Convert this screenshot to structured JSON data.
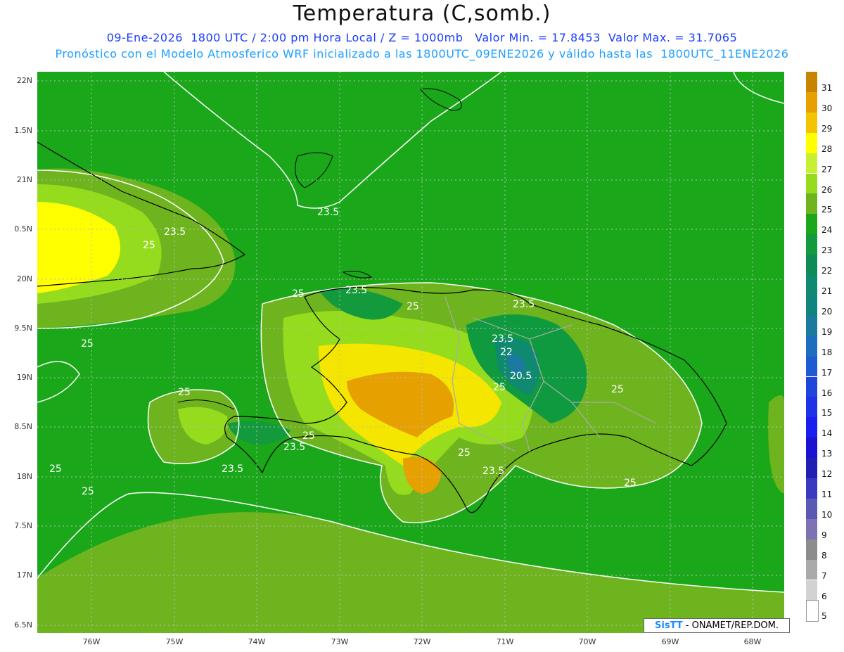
{
  "title": "Temperatura (C,somb.)",
  "subtitle_line1": "09-Ene-2026  1800 UTC / 2:00 pm Hora Local / Z = 1000mb   Valor Min. = 17.8453  Valor Max. = 31.7065",
  "subtitle_line2": "Pronóstico con el Modelo Atmosferico WRF inicializado a las 1800UTC_09ENE2026 y válido hasta las  1800UTC_11ENE2026",
  "credit": {
    "brand": "SisTT",
    "text": " - ONAMET/REP.DOM."
  },
  "lat_labels": [
    "22N",
    "1.5N",
    "21N",
    "0.5N",
    "20N",
    "9.5N",
    "19N",
    "8.5N",
    "18N",
    "7.5N",
    "17N",
    "6.5N"
  ],
  "lon_labels": [
    "76W",
    "75W",
    "74W",
    "73W",
    "72W",
    "71W",
    "70W",
    "69W",
    "68W"
  ],
  "contour_labels": [
    "23.5",
    "23.5",
    "25",
    "23.5",
    "25",
    "23.5",
    "25",
    "23.5",
    "23.5",
    "22",
    "20.5",
    "25",
    "25",
    "25",
    "23.5",
    "25",
    "25",
    "25",
    "25",
    "23.5",
    "25",
    "25"
  ],
  "colorbar": {
    "levels": [
      "31",
      "30",
      "29",
      "28",
      "27",
      "26",
      "25",
      "24",
      "23",
      "22",
      "21",
      "20",
      "19",
      "18",
      "17",
      "16",
      "15",
      "14",
      "13",
      "12",
      "11",
      "10",
      "9",
      "8",
      "7",
      "6",
      "5"
    ],
    "colors": [
      "#c88400",
      "#e6a000",
      "#f5c400",
      "#ffff00",
      "#c8f032",
      "#96dc1e",
      "#6eb41e",
      "#1aa81a",
      "#129a3c",
      "#0f8c55",
      "#0f8a70",
      "#12847e",
      "#1a7aa0",
      "#1e6ec0",
      "#1e5ad2",
      "#1e46dc",
      "#1e32e6",
      "#1a1ef0",
      "#1a14d2",
      "#2020b4",
      "#3a3ac0",
      "#5a5ab4",
      "#7e72b4",
      "#8c8c8c",
      "#aaaaaa",
      "#d2d2d2",
      "#ffffff"
    ]
  }
}
